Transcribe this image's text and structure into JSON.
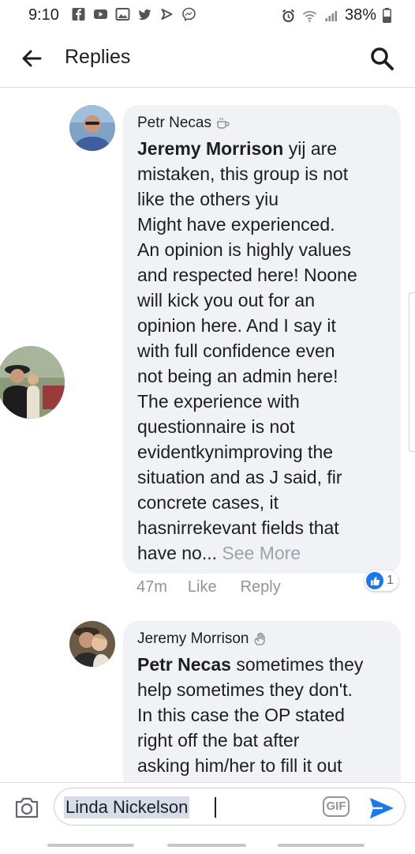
{
  "status_bar": {
    "time": "9:10",
    "battery": "38%",
    "left_icons": [
      "facebook-icon",
      "youtube-icon",
      "gallery-icon",
      "twitter-icon",
      "feedly-icon",
      "messenger-icon"
    ],
    "right_icons": [
      "alarm-icon",
      "wifi-icon",
      "signal-icon",
      "battery-icon"
    ]
  },
  "header": {
    "title": "Replies"
  },
  "comments": [
    {
      "author": "Petr Necas",
      "author_icon": "coffee-cup-icon",
      "mention": "Jeremy Morrison",
      "lines": [
        "yij are",
        "mistaken, this group is not",
        "like the others yiu",
        "Might have experienced.",
        "An opinion is highly values",
        "and respected here! Noone",
        "will kick you out for an",
        "opinion here. And I say it",
        "with full confidence even",
        "not being an admin here!",
        "The experience with",
        "questionnaire is not",
        "evidentkynimproving the",
        "situation and as J said, fir",
        "concrete cases, it",
        "hasnirrekevant fields that",
        "have no..."
      ],
      "see_more": "See More",
      "time": "47m",
      "like": "Like",
      "reply": "Reply",
      "reaction_count": "1"
    },
    {
      "author": "Jeremy Morrison",
      "author_icon": "waving-hand-icon",
      "mention": "Petr Necas",
      "lines": [
        "sometimes they",
        "help sometimes they don't.",
        "In this case the OP stated",
        "right off the bat after",
        "asking him/her to fill it out"
      ]
    }
  ],
  "composer": {
    "value": "Linda Nickelson",
    "gif_label": "GIF"
  },
  "colors": {
    "accent": "#1877f2",
    "bubble": "#f0f2f5",
    "muted": "#8d949e"
  }
}
